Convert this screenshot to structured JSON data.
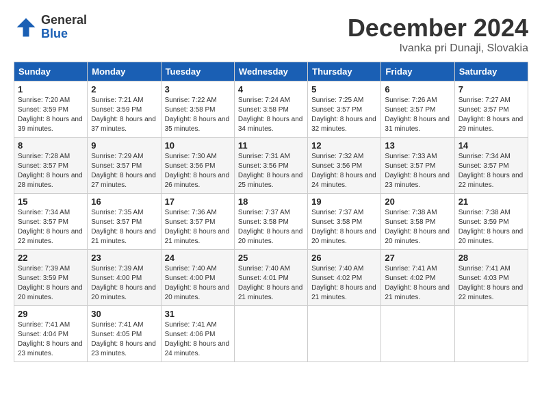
{
  "logo": {
    "general": "General",
    "blue": "Blue"
  },
  "title": {
    "month": "December 2024",
    "location": "Ivanka pri Dunaji, Slovakia"
  },
  "weekdays": [
    "Sunday",
    "Monday",
    "Tuesday",
    "Wednesday",
    "Thursday",
    "Friday",
    "Saturday"
  ],
  "weeks": [
    [
      {
        "day": "1",
        "sunrise": "7:20 AM",
        "sunset": "3:59 PM",
        "daylight": "8 hours and 39 minutes."
      },
      {
        "day": "2",
        "sunrise": "7:21 AM",
        "sunset": "3:59 PM",
        "daylight": "8 hours and 37 minutes."
      },
      {
        "day": "3",
        "sunrise": "7:22 AM",
        "sunset": "3:58 PM",
        "daylight": "8 hours and 35 minutes."
      },
      {
        "day": "4",
        "sunrise": "7:24 AM",
        "sunset": "3:58 PM",
        "daylight": "8 hours and 34 minutes."
      },
      {
        "day": "5",
        "sunrise": "7:25 AM",
        "sunset": "3:57 PM",
        "daylight": "8 hours and 32 minutes."
      },
      {
        "day": "6",
        "sunrise": "7:26 AM",
        "sunset": "3:57 PM",
        "daylight": "8 hours and 31 minutes."
      },
      {
        "day": "7",
        "sunrise": "7:27 AM",
        "sunset": "3:57 PM",
        "daylight": "8 hours and 29 minutes."
      }
    ],
    [
      {
        "day": "8",
        "sunrise": "7:28 AM",
        "sunset": "3:57 PM",
        "daylight": "8 hours and 28 minutes."
      },
      {
        "day": "9",
        "sunrise": "7:29 AM",
        "sunset": "3:57 PM",
        "daylight": "8 hours and 27 minutes."
      },
      {
        "day": "10",
        "sunrise": "7:30 AM",
        "sunset": "3:56 PM",
        "daylight": "8 hours and 26 minutes."
      },
      {
        "day": "11",
        "sunrise": "7:31 AM",
        "sunset": "3:56 PM",
        "daylight": "8 hours and 25 minutes."
      },
      {
        "day": "12",
        "sunrise": "7:32 AM",
        "sunset": "3:56 PM",
        "daylight": "8 hours and 24 minutes."
      },
      {
        "day": "13",
        "sunrise": "7:33 AM",
        "sunset": "3:57 PM",
        "daylight": "8 hours and 23 minutes."
      },
      {
        "day": "14",
        "sunrise": "7:34 AM",
        "sunset": "3:57 PM",
        "daylight": "8 hours and 22 minutes."
      }
    ],
    [
      {
        "day": "15",
        "sunrise": "7:34 AM",
        "sunset": "3:57 PM",
        "daylight": "8 hours and 22 minutes."
      },
      {
        "day": "16",
        "sunrise": "7:35 AM",
        "sunset": "3:57 PM",
        "daylight": "8 hours and 21 minutes."
      },
      {
        "day": "17",
        "sunrise": "7:36 AM",
        "sunset": "3:57 PM",
        "daylight": "8 hours and 21 minutes."
      },
      {
        "day": "18",
        "sunrise": "7:37 AM",
        "sunset": "3:58 PM",
        "daylight": "8 hours and 20 minutes."
      },
      {
        "day": "19",
        "sunrise": "7:37 AM",
        "sunset": "3:58 PM",
        "daylight": "8 hours and 20 minutes."
      },
      {
        "day": "20",
        "sunrise": "7:38 AM",
        "sunset": "3:58 PM",
        "daylight": "8 hours and 20 minutes."
      },
      {
        "day": "21",
        "sunrise": "7:38 AM",
        "sunset": "3:59 PM",
        "daylight": "8 hours and 20 minutes."
      }
    ],
    [
      {
        "day": "22",
        "sunrise": "7:39 AM",
        "sunset": "3:59 PM",
        "daylight": "8 hours and 20 minutes."
      },
      {
        "day": "23",
        "sunrise": "7:39 AM",
        "sunset": "4:00 PM",
        "daylight": "8 hours and 20 minutes."
      },
      {
        "day": "24",
        "sunrise": "7:40 AM",
        "sunset": "4:00 PM",
        "daylight": "8 hours and 20 minutes."
      },
      {
        "day": "25",
        "sunrise": "7:40 AM",
        "sunset": "4:01 PM",
        "daylight": "8 hours and 21 minutes."
      },
      {
        "day": "26",
        "sunrise": "7:40 AM",
        "sunset": "4:02 PM",
        "daylight": "8 hours and 21 minutes."
      },
      {
        "day": "27",
        "sunrise": "7:41 AM",
        "sunset": "4:02 PM",
        "daylight": "8 hours and 21 minutes."
      },
      {
        "day": "28",
        "sunrise": "7:41 AM",
        "sunset": "4:03 PM",
        "daylight": "8 hours and 22 minutes."
      }
    ],
    [
      {
        "day": "29",
        "sunrise": "7:41 AM",
        "sunset": "4:04 PM",
        "daylight": "8 hours and 23 minutes."
      },
      {
        "day": "30",
        "sunrise": "7:41 AM",
        "sunset": "4:05 PM",
        "daylight": "8 hours and 23 minutes."
      },
      {
        "day": "31",
        "sunrise": "7:41 AM",
        "sunset": "4:06 PM",
        "daylight": "8 hours and 24 minutes."
      },
      null,
      null,
      null,
      null
    ]
  ]
}
